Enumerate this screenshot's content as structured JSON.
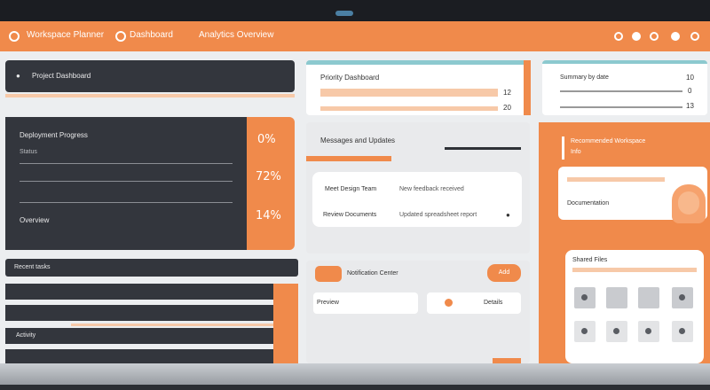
{
  "topbar": {
    "item1": "Workspace Planner",
    "item2": "Dashboard",
    "item3": "Analytics Overview"
  },
  "left": {
    "header_title": "Project Dashboard",
    "panel_title": "Deployment Progress",
    "panel_sub": "Status",
    "panel_footer": "Overview",
    "pct": [
      "0%",
      "72%",
      "14%"
    ],
    "list_title": "Recent tasks",
    "list_footer": "Activity"
  },
  "middle": {
    "top_title": "Priority Dashboard",
    "row_vals": [
      "12",
      "20"
    ],
    "section_title": "Messages and Updates",
    "rows": [
      {
        "label": "Meet Design Team",
        "value": "New feedback received"
      },
      {
        "label": "Review Documents",
        "value": "Updated spreadsheet report"
      }
    ],
    "feed_title": "Notification Center",
    "feed_btn": "Add",
    "feed_left": "Preview",
    "feed_right": "Details"
  },
  "right": {
    "top_title": "Summary by date",
    "top_vals": [
      "10",
      "0",
      "13"
    ],
    "panel_title": "Recommended Workspace",
    "panel_sub": "Info",
    "profile_label": "Documentation",
    "files_title": "Shared Files"
  },
  "colors": {
    "accent": "#f08a4b",
    "dark": "#33363d",
    "peach": "#f7c9a8"
  }
}
